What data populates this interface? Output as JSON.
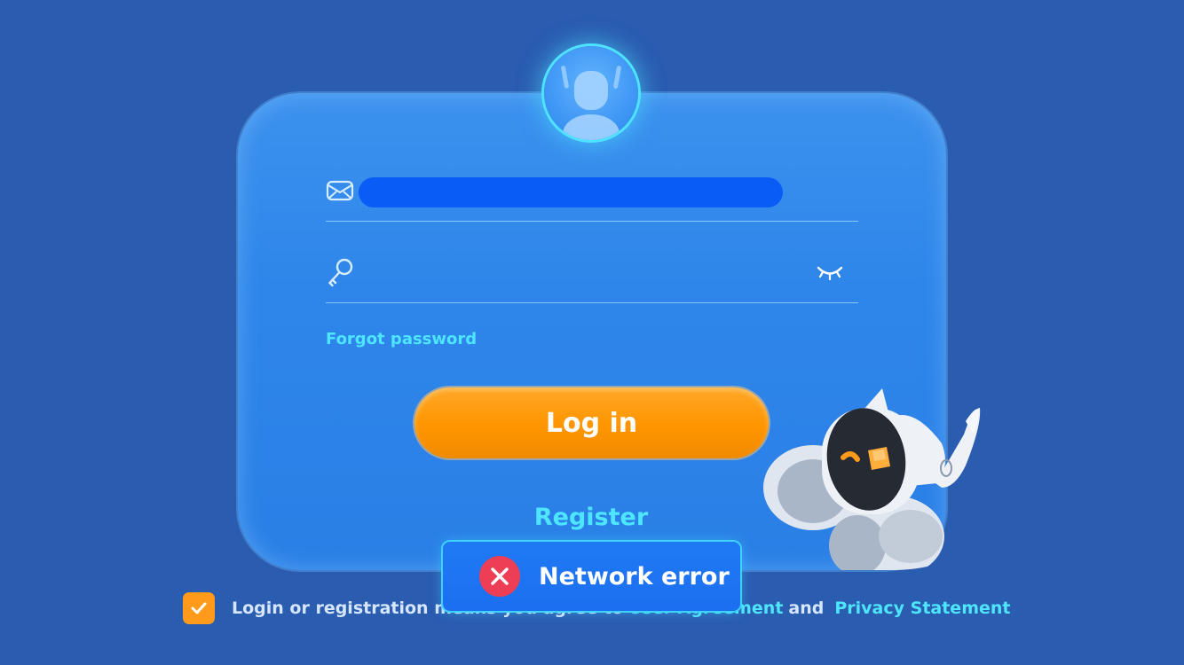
{
  "login_form": {
    "email_value": "",
    "password_value": "",
    "password_placeholder": "",
    "forgot_password_label": "Forgot password",
    "login_button_label": "Log in",
    "register_label": "Register"
  },
  "agreement": {
    "checked": true,
    "text": "Login or registration means you agree to",
    "user_agreement_label": "User Agreement",
    "and_text": "and",
    "privacy_label": "Privacy Statement"
  },
  "toast": {
    "message": "Network error",
    "icon": "error-x-icon"
  },
  "icons": {
    "email": "mail-icon",
    "password": "key-icon",
    "visibility": "eye-closed-icon",
    "avatar": "user-avatar-icon",
    "checkbox": "checkmark-icon"
  },
  "colors": {
    "background": "#2a5cb0",
    "card": "#2f86ea",
    "accent_cyan": "#4ee6ff",
    "primary_orange": "#ff9500",
    "error_red": "#ee3e55"
  }
}
